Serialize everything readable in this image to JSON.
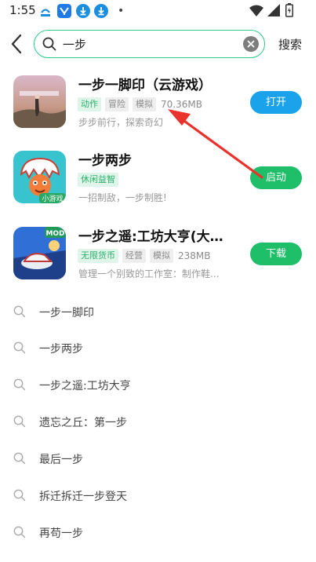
{
  "status_bar": {
    "time": "1:55",
    "dot": "•"
  },
  "search": {
    "query": "一步",
    "action_label": "搜索"
  },
  "results": [
    {
      "title": "一步一脚印（云游戏）",
      "tags": [
        {
          "label": "动作",
          "style": "green"
        },
        {
          "label": "冒险",
          "style": "gray"
        },
        {
          "label": "模拟",
          "style": "gray"
        }
      ],
      "size": "70.36MB",
      "description": "步步前行，探索奇幻",
      "button": "打开",
      "button_color": "#1aa3ea",
      "icon": "game-icon-baby-steps"
    },
    {
      "title": "一步两步",
      "tags": [
        {
          "label": "休闲益智",
          "style": "green"
        }
      ],
      "size": "",
      "description": "一招制敌，一步制胜!",
      "button": "启动",
      "button_color": "#1fbe69",
      "icon": "game-icon-mini-game",
      "icon_badge": "小游戏"
    },
    {
      "title": "一步之遥:工坊大亨(大量...",
      "tags": [
        {
          "label": "无限货币",
          "style": "green"
        },
        {
          "label": "经营",
          "style": "gray"
        },
        {
          "label": "模拟",
          "style": "gray"
        }
      ],
      "size": "238MB",
      "description": "管理一个别致的工作室：制作鞋...",
      "button": "下载",
      "button_color": "#1fbe69",
      "icon": "game-icon-workshop",
      "icon_badge": "MOD"
    }
  ],
  "suggestions": [
    "一步一脚印",
    "一步两步",
    "一步之遥:工坊大亨",
    "遗忘之丘：第一步",
    "最后一步",
    "拆迁拆迁一步登天",
    "再苟一步"
  ],
  "colors": {
    "accent_green": "#2ec989",
    "annotation_arrow": "#e8322b"
  }
}
